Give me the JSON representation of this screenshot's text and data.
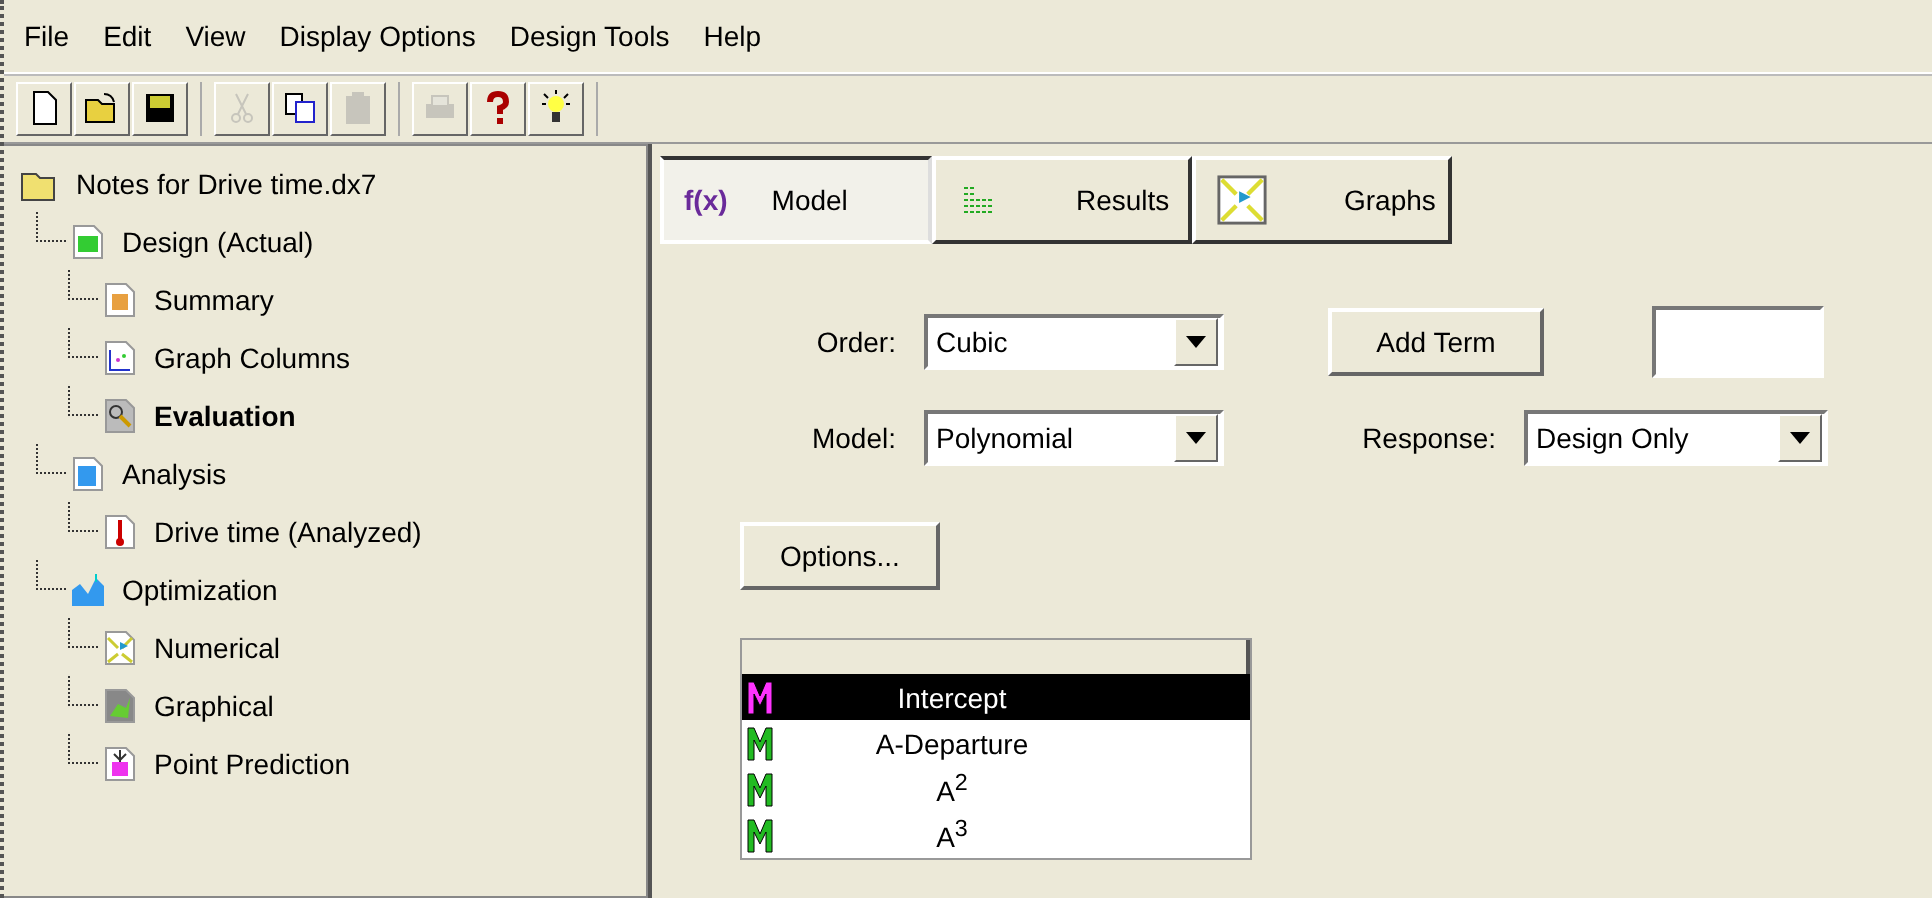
{
  "menu": [
    "File",
    "Edit",
    "View",
    "Display Options",
    "Design Tools",
    "Help"
  ],
  "toolbar": [
    [
      {
        "kind": "new",
        "disabled": false
      },
      {
        "kind": "open",
        "disabled": false
      },
      {
        "kind": "save",
        "disabled": false
      }
    ],
    [
      {
        "kind": "cut",
        "disabled": true
      },
      {
        "kind": "copy",
        "disabled": false
      },
      {
        "kind": "paste",
        "disabled": true
      }
    ],
    [
      {
        "kind": "print",
        "disabled": true
      },
      {
        "kind": "help",
        "disabled": false
      },
      {
        "kind": "tip",
        "disabled": false
      }
    ]
  ],
  "tree": {
    "label": "Notes for Drive time.dx7",
    "kind": "folder",
    "selected": false,
    "children": [
      {
        "label": "Design (Actual)",
        "kind": "design",
        "selected": false,
        "children": [
          {
            "label": "Summary",
            "kind": "summary",
            "selected": false
          },
          {
            "label": "Graph Columns",
            "kind": "graph",
            "selected": false
          },
          {
            "label": "Evaluation",
            "kind": "evaluation",
            "selected": true
          }
        ]
      },
      {
        "label": "Analysis",
        "kind": "analysis",
        "selected": false,
        "children": [
          {
            "label": "Drive time (Analyzed)",
            "kind": "thermometer",
            "selected": false
          }
        ]
      },
      {
        "label": "Optimization",
        "kind": "optimization",
        "selected": false,
        "children": [
          {
            "label": "Numerical",
            "kind": "numerical",
            "selected": false
          },
          {
            "label": "Graphical",
            "kind": "graphical",
            "selected": false
          },
          {
            "label": "Point Prediction",
            "kind": "prediction",
            "selected": false
          }
        ]
      }
    ]
  },
  "tabs": [
    {
      "label": "Model",
      "kind": "fx",
      "icon_text": "f(x)",
      "selected": true
    },
    {
      "label": "Results",
      "kind": "results",
      "selected": false
    },
    {
      "label": "Graphs",
      "kind": "graphs",
      "selected": false
    }
  ],
  "order": {
    "label": "Order:",
    "value": "Cubic"
  },
  "model": {
    "label": "Model:",
    "value": "Polynomial"
  },
  "add_term": "Add Term",
  "response": {
    "label": "Response:",
    "value": "Design Only"
  },
  "options": "Options...",
  "terms": [
    {
      "name": "Intercept",
      "color": "#ff33ff",
      "selected": true
    },
    {
      "name": "A-Departure",
      "color": "#22bb22",
      "selected": false
    },
    {
      "name": "A$^{2}$",
      "color": "#22bb22",
      "selected": false
    },
    {
      "name": "A$^{3}$",
      "color": "#22bb22",
      "selected": false
    }
  ]
}
